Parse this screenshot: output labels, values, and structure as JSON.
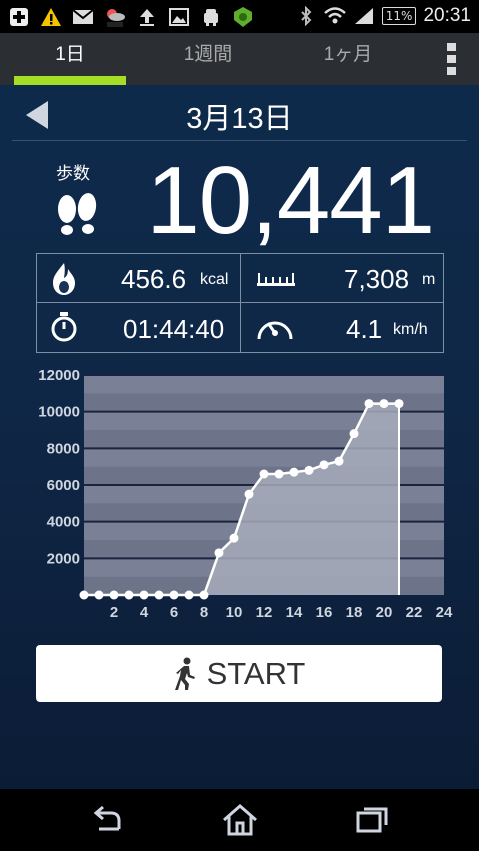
{
  "status_bar": {
    "icons": [
      "plus-icon",
      "warning-icon",
      "mail-icon",
      "weather-icon",
      "upload-icon",
      "image-icon",
      "android-icon",
      "shield-icon",
      "bluetooth-icon",
      "wifi-icon",
      "signal-icon"
    ],
    "battery": "11%",
    "time": "20:31"
  },
  "tabs": [
    {
      "label": "1日",
      "active": true
    },
    {
      "label": "1週間",
      "active": false
    },
    {
      "label": "1ヶ月",
      "active": false
    }
  ],
  "date": "3月13日",
  "steps": {
    "label": "歩数",
    "value": "10,441"
  },
  "stats": {
    "calories": {
      "value": "456.6",
      "unit": "kcal"
    },
    "distance": {
      "value": "7,308",
      "unit": "m"
    },
    "time": {
      "value": "01:44:40"
    },
    "speed": {
      "value": "4.1",
      "unit": "km/h"
    }
  },
  "chart_data": {
    "type": "area",
    "x": [
      0,
      1,
      2,
      3,
      4,
      5,
      6,
      7,
      8,
      9,
      10,
      11,
      12,
      13,
      14,
      15,
      16,
      17,
      18,
      19,
      20,
      21
    ],
    "values": [
      0,
      0,
      0,
      0,
      0,
      0,
      0,
      0,
      0,
      2300,
      3100,
      5500,
      6600,
      6600,
      6700,
      6800,
      7100,
      7300,
      8800,
      10441,
      10441,
      10441
    ],
    "xticks": [
      "2",
      "4",
      "6",
      "8",
      "10",
      "12",
      "14",
      "16",
      "18",
      "20",
      "22",
      "24"
    ],
    "yticks": [
      "2000",
      "4000",
      "6000",
      "8000",
      "10000",
      "12000"
    ],
    "xlim": [
      0,
      24
    ],
    "ylim": [
      0,
      12000
    ],
    "colors": {
      "fill": "#a6acba",
      "line": "#ffffff",
      "plot_bg": "#7a8096"
    }
  },
  "start_button": {
    "label": "START"
  },
  "nav": [
    "back-icon",
    "home-icon",
    "recent-apps-icon"
  ]
}
